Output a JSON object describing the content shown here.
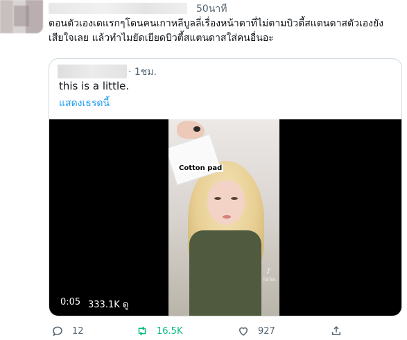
{
  "tweet": {
    "timestamp": "50นาที",
    "text": "ตอนตัวเองเดแรกๆโดนคนเกาหลีบูลลี่เรื่องหน้าตาที่ไม่ตามบิวตี้สแตนดาสตัวเองยังเสียใจเลย แล้วทำไมยัดเยียดบิวตี้สแตนดาสใส่คนอื่นอะ"
  },
  "quote": {
    "time": "· 1ชม.",
    "text": "this is a little.",
    "show_thread": "แสดงเธรดนี้",
    "video": {
      "caption": "Cotton pad",
      "tiktok_label": "TikTok",
      "elapsed": "0:05",
      "views": "333.1K ดู"
    }
  },
  "actions": {
    "reply_count": "12",
    "retweet_count": "16.5K",
    "like_count": "927"
  },
  "colors": {
    "accent": "#1d9bf0",
    "retweet": "#00ba7c",
    "muted": "#536471"
  }
}
